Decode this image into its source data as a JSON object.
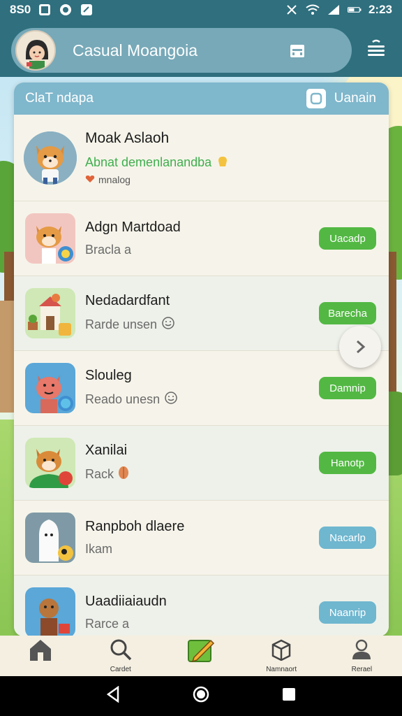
{
  "status_bar": {
    "time": "8S0",
    "clock_right": "2:23",
    "left_icons": [
      "photo-icon",
      "chat-icon",
      "notification-icon"
    ],
    "right_icons": [
      "mute-icon",
      "wifi-icon",
      "signal-icon",
      "battery-icon"
    ]
  },
  "header": {
    "title": "Casual Moangoia",
    "avatar": "user-avatar",
    "action_icon": "calendar-icon",
    "menu_icon": "menu-icon"
  },
  "card": {
    "title": "ClaT ndapa",
    "right_label": "Uanain",
    "featured": {
      "name": "Moak Aslaoh",
      "subtitle": "Abnat demenlanandba",
      "meta": "mnalog"
    },
    "rows": [
      {
        "name": "Adgn Martdoad",
        "sub": "Bracla a",
        "button": "Uacadp",
        "button_color": "#52b843",
        "sub_icon": ""
      },
      {
        "name": "Nedadardfant",
        "sub": "Rarde unsen",
        "button": "Barecha",
        "button_color": "#52b843",
        "sub_icon": "smile-icon"
      },
      {
        "name": "Slouleg",
        "sub": "Reado unesn",
        "button": "Damnip",
        "button_color": "#52b843",
        "sub_icon": "smile-icon"
      },
      {
        "name": "Xanilai",
        "sub": "Rack",
        "button": "Hanotp",
        "button_color": "#52b843",
        "sub_icon": "leaf-icon"
      },
      {
        "name": "Ranpboh dlaere",
        "sub": "Ikam",
        "button": "Nacarlp",
        "button_color": "#6fb6cf",
        "sub_icon": ""
      },
      {
        "name": "Uaadiiaiaudn",
        "sub": "Rarce a",
        "button": "Naanrip",
        "button_color": "#6fb6cf",
        "sub_icon": ""
      }
    ]
  },
  "bottom_nav": [
    {
      "label": "",
      "icon": "home-icon"
    },
    {
      "label": "Cardet",
      "icon": "search-icon"
    },
    {
      "label": "",
      "icon": "edit-icon"
    },
    {
      "label": "Namnaort",
      "icon": "box-icon"
    },
    {
      "label": "Rerael",
      "icon": "profile-icon"
    }
  ],
  "colors": {
    "header": "#2f6f7e",
    "header_pill": "#77a9b8",
    "card_head": "#7fb7cc",
    "green_button": "#52b843",
    "blue_button": "#6fb6cf"
  }
}
